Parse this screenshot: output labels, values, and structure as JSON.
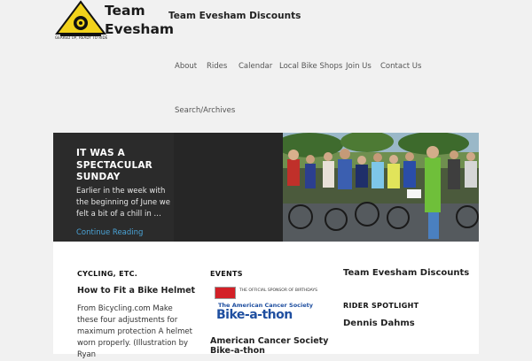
{
  "header": {
    "site_title_line1": "Team",
    "site_title_line2": "Evesham",
    "logo_caption": "GEARED UP, READY TO RIDE",
    "tagline": "Team Evesham Discounts"
  },
  "nav": {
    "items": [
      "About",
      "Rides",
      "Calendar",
      "Local Bike Shops",
      "Join Us",
      "Contact Us",
      "Search/Archives"
    ]
  },
  "featured": {
    "title": "IT WAS A SPECTACULAR SUNDAY",
    "excerpt": "Earlier in the week with the beginning of June we felt a bit of a chill in …",
    "link": "Continue Reading"
  },
  "widgets": {
    "col1": {
      "heading": "CYCLING, ETC.",
      "post_title": "How to Fit a Bike Helmet",
      "text": "From Bicycling.com Make these four adjustments for maximum protection A helmet worn properly. (Illustration by Ryan"
    },
    "col2": {
      "heading": "EVENTS",
      "sponsor_text": "THE OFFICIAL SPONSOR OF BIRTHDAYS",
      "acs_line": "The American Cancer Society",
      "bikeathon": "Bike-a-thon",
      "post_title_line1": "American Cancer Society",
      "post_title_line2": "Bike-a-thon"
    },
    "col3": {
      "title": "Team Evesham Discounts",
      "heading": "RIDER SPOTLIGHT",
      "name": "Dennis Dahms"
    }
  },
  "colors": {
    "accent_link": "#4aa3d6",
    "featured_bg": "#2b2b2b",
    "page_bg": "#f1f1f1"
  }
}
